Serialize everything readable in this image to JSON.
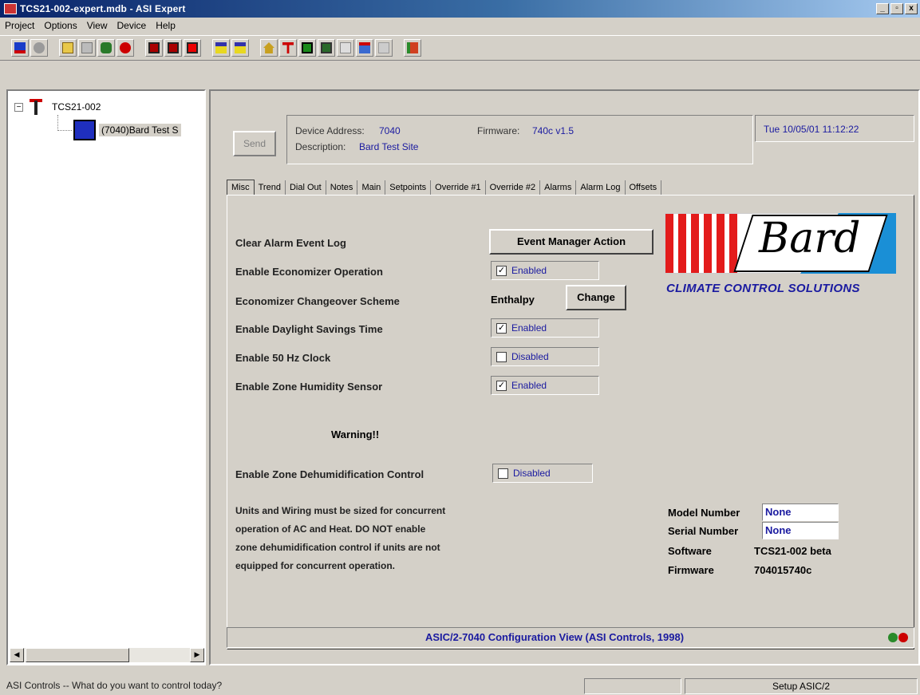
{
  "window": {
    "title": "TCS21-002-expert.mdb - ASI Expert",
    "controls": [
      "_",
      "▫",
      "x"
    ]
  },
  "menu": [
    "Project",
    "Options",
    "View",
    "Device",
    "Help"
  ],
  "toolbar": {
    "icons": [
      "connect-icon",
      "disk-icon",
      "folder-icon",
      "grid-icon",
      "binoculars-icon",
      "record-icon",
      "save-icon",
      "save-as-icon",
      "save-all-icon",
      "dos-icon",
      "dos-2-icon",
      "home-icon",
      "ti-icon",
      "monitor-icon",
      "panel-icon",
      "plot-icon",
      "bw-icon",
      "doc-icon",
      "chart-icon"
    ]
  },
  "tree": {
    "root_label": "TCS21-002",
    "child_label": "(7040)Bard Test S"
  },
  "device": {
    "send_label": "Send",
    "address_label": "Device Address:",
    "address_value": "7040",
    "firmware_label": "Firmware:",
    "firmware_value": "740c v1.5",
    "description_label": "Description:",
    "description_value": "Bard Test Site",
    "datetime": "Tue 10/05/01 11:12:22"
  },
  "tabs": [
    "Misc",
    "Trend",
    "Dial Out",
    "Notes",
    "Main",
    "Setpoints",
    "Override #1",
    "Override #2",
    "Alarms",
    "Alarm Log",
    "Offsets"
  ],
  "misc": {
    "clear_alarm_label": "Clear Alarm Event Log",
    "event_button": "Event Manager Action",
    "econ_label": "Enable Economizer Operation",
    "econ_state": "Enabled",
    "scheme_label": "Economizer Changeover Scheme",
    "scheme_value": "Enthalpy",
    "change_button": "Change",
    "dst_label": "Enable Daylight Savings Time",
    "dst_state": "Enabled",
    "hz_label": "Enable 50 Hz Clock",
    "hz_state": "Disabled",
    "humidity_label": "Enable Zone Humidity Sensor",
    "humidity_state": "Enabled",
    "warning": "Warning!!",
    "dehumid_label": "Enable Zone Dehumidification Control",
    "dehumid_state": "Disabled",
    "para_lines": [
      "Units and Wiring must be sized for concurrent",
      "operation of AC and Heat. DO NOT enable",
      "zone dehumidification control if units are not",
      "equipped for concurrent operation."
    ]
  },
  "logo": {
    "word": "Bard",
    "tagline": "CLIMATE CONTROL SOLUTIONS"
  },
  "info": {
    "model_label": "Model Number",
    "model_value": "None",
    "serial_label": "Serial Number",
    "serial_value": "None",
    "software_label": "Software",
    "software_value": "TCS21-002 beta",
    "firmware_label": "Firmware",
    "firmware_value": "704015740c"
  },
  "config_status": "ASIC/2-7040 Configuration View (ASI Controls, 1998)",
  "statusbar": {
    "message": "ASI Controls -- What do you want to control today?",
    "right": "Setup ASIC/2"
  },
  "colors": {
    "accent_blue": "#1a1aa0",
    "title_blue": "#0a246a",
    "bard_red": "#e31b1b",
    "bard_blue": "#1a8fd6"
  }
}
